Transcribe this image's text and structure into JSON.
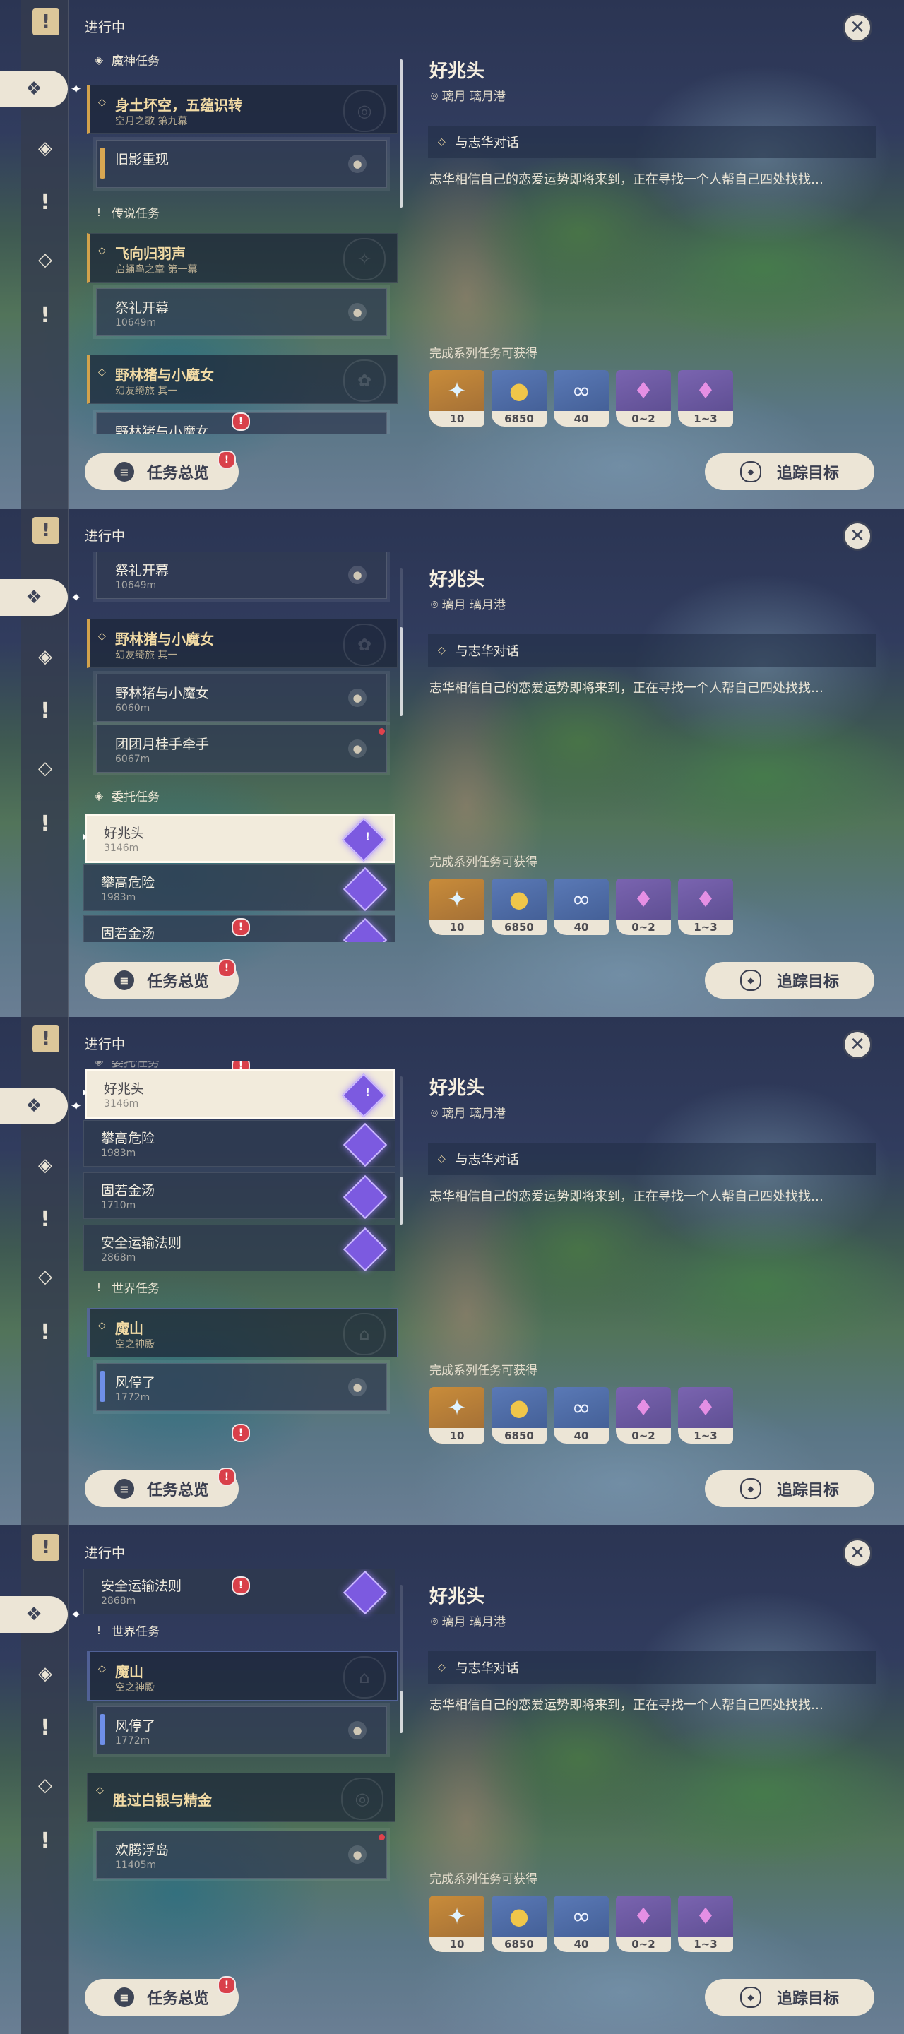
{
  "header": {
    "in_progress_label": "进行中",
    "close_icon": "close-icon"
  },
  "detail": {
    "title": "好兆头",
    "location": "璃月 璃月港",
    "objective": "与志华对话",
    "description": "志华相信自己的恋爱运势即将来到，正在寻找一个人帮自己四处找找…",
    "rewards_label": "完成系列任务可获得",
    "rewards": [
      {
        "name": "primogem",
        "count": "10"
      },
      {
        "name": "mora",
        "count": "6850"
      },
      {
        "name": "adventure-exp",
        "count": "40"
      },
      {
        "name": "crystal-chunk",
        "count": "0~2"
      },
      {
        "name": "crystal-cluster",
        "count": "1~3"
      }
    ]
  },
  "buttons": {
    "overview": "任务总览",
    "track": "追踪目标"
  },
  "quests": {
    "archon_section": "魔神任务",
    "archon": {
      "title": "身土坏空，五蕴识转",
      "subtitle": "空月之歌 第九幕"
    },
    "archon_step": {
      "title": "旧影重现"
    },
    "legend_section": "传说任务",
    "legend1": {
      "title": "飞向归羽声",
      "subtitle": "启蛹鸟之章 第一幕"
    },
    "legend1_step": {
      "title": "祭礼开幕",
      "distance": "10649m"
    },
    "legend2": {
      "title": "野林猪与小魔女",
      "subtitle": "幻友绮旅 其一"
    },
    "legend2_step1": {
      "title": "野林猪与小魔女",
      "distance": "6060m"
    },
    "legend2_step2": {
      "title": "团团月桂手牵手",
      "distance": "6067m"
    },
    "commission_section": "委托任务",
    "commissions": [
      {
        "title": "好兆头",
        "distance": "3146m"
      },
      {
        "title": "攀高危险",
        "distance": "1983m"
      },
      {
        "title": "固若金汤",
        "distance": "1710m"
      },
      {
        "title": "安全运输法则",
        "distance": "2868m"
      }
    ],
    "world_section": "世界任务",
    "world1": {
      "title": "魔山",
      "subtitle": "空之神殿"
    },
    "world1_step": {
      "title": "风停了",
      "distance": "1772m"
    },
    "world2": {
      "title": "胜过白银与精金"
    },
    "world2_step": {
      "title": "欢腾浮岛",
      "distance": "11405m"
    }
  }
}
